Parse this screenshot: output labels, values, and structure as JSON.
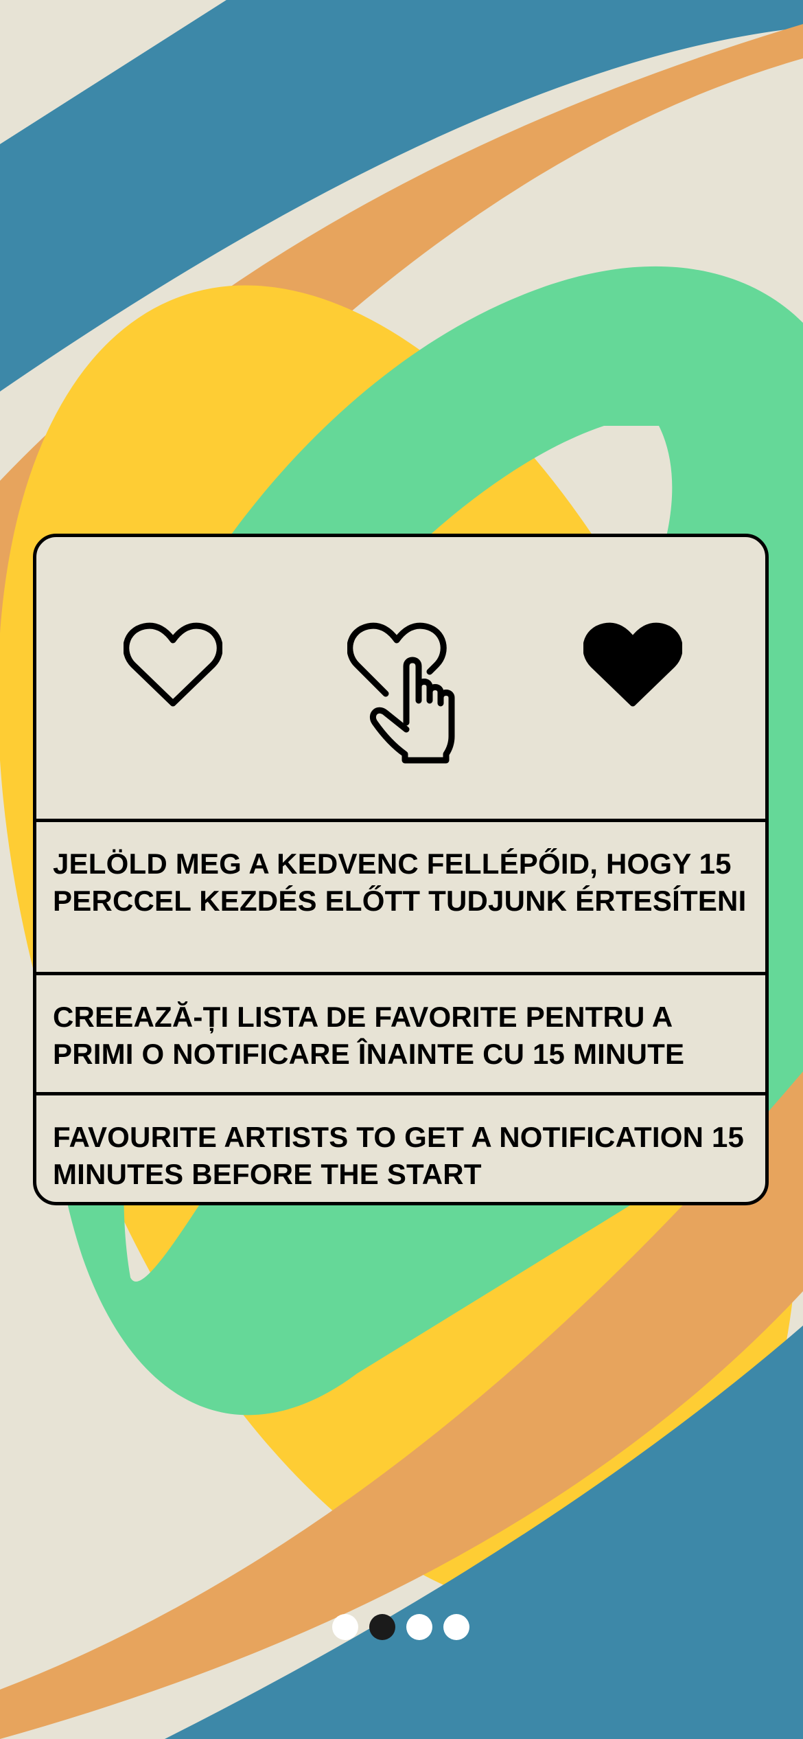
{
  "colors": {
    "background": "#E7E3D5",
    "band_blue": "#3D88A8",
    "band_orange": "#E7A45D",
    "blob_yellow": "#FECD34",
    "ring_green": "#65D898",
    "ink": "#000000",
    "dot_inactive": "#FFFFFF",
    "dot_active": "#1B1B1B"
  },
  "card": {
    "icons": [
      {
        "name": "heart-outline-icon"
      },
      {
        "name": "heart-tap-icon"
      },
      {
        "name": "heart-filled-icon"
      }
    ],
    "text_hu": "JELÖLD MEG A KEDVENC FELLÉPŐID, HOGY 15 PERCCEL KEZDÉS ELŐTT TUDJUNK ÉRTESÍTENI",
    "text_ro": "CREEAZĂ-ȚI LISTA DE FAVORITE PENTRU A PRIMI O NOTIFICARE ÎNAINTE CU 15 MINUTE",
    "text_en": "FAVOURITE ARTISTS TO GET A NOTIFICATION 15 MINUTES BEFORE THE START"
  },
  "pager": {
    "total": 4,
    "current": 2
  }
}
